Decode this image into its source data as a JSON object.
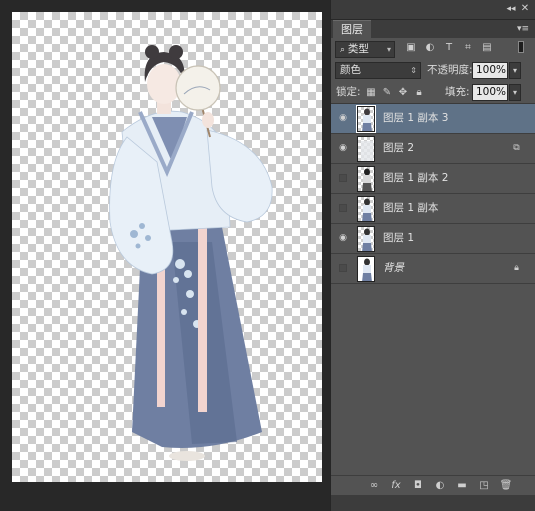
{
  "panel": {
    "tab_label": "图层",
    "filter_kind": "类型",
    "blend_mode": "颜色",
    "opacity_label": "不透明度:",
    "opacity_value": "100%",
    "lock_label": "锁定:",
    "fill_label": "填充:",
    "fill_value": "100%"
  },
  "layers": [
    {
      "name": "图层 1 副本 3",
      "visible": true,
      "selected": true
    },
    {
      "name": "图层 2",
      "visible": true,
      "selected": false,
      "badge": "smart-object-icon"
    },
    {
      "name": "图层 1 副本 2",
      "visible": false,
      "selected": false
    },
    {
      "name": "图层 1 副本",
      "visible": false,
      "selected": false
    },
    {
      "name": "图层 1",
      "visible": true,
      "selected": false
    },
    {
      "name": "背景",
      "visible": false,
      "selected": false,
      "badge": "lock-icon",
      "italic": true
    }
  ],
  "icons": {
    "eye": "eye-icon",
    "bottom_bar": [
      "link-icon",
      "fx-icon",
      "mask-icon",
      "adjustment-icon",
      "group-icon",
      "new-layer-icon",
      "trash-icon"
    ]
  },
  "colors": {
    "panel_bg": "#535353",
    "selected_layer": "#5f7287",
    "robe": "#e6eef6",
    "skirt": "#6f7fa2",
    "ribbon": "#f2d4cf"
  }
}
